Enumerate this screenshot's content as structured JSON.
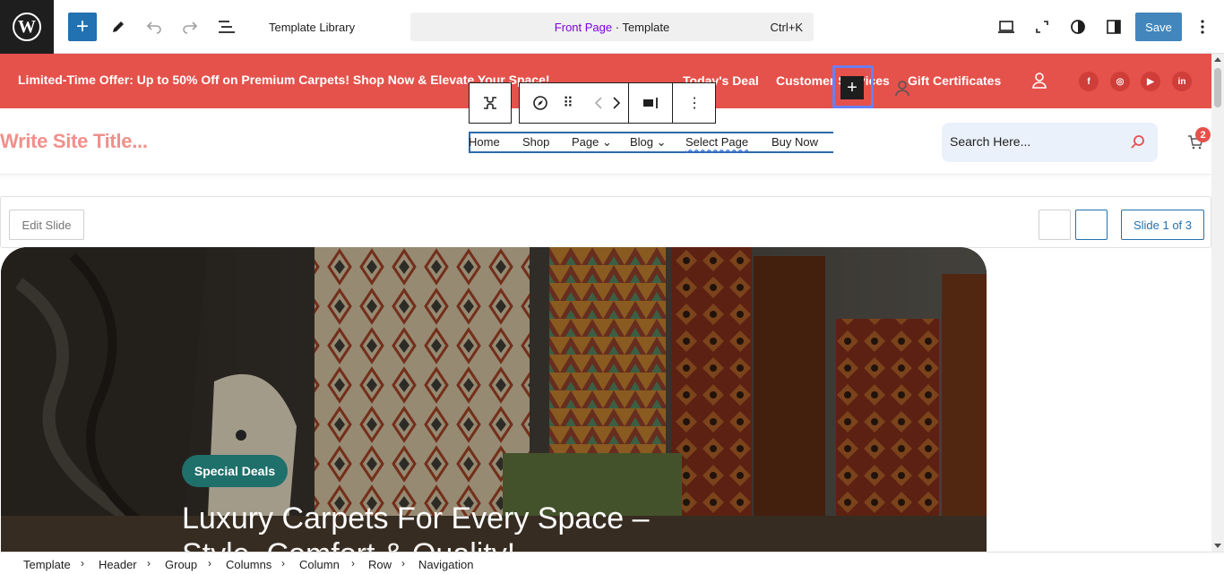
{
  "editor": {
    "template_library": "Template Library",
    "command": {
      "page": "Front Page",
      "sep": " · ",
      "type": "Template",
      "shortcut": "Ctrl+K"
    },
    "save": "Save",
    "wp": "W",
    "add": "+"
  },
  "promo": {
    "offer": "Limited-Time Offer: Up to 50% Off on Premium Carpets! Shop Now & Elevate Your Space!",
    "links": [
      "Today's Deal",
      "Customer Services",
      "Gift Certificates"
    ],
    "social": [
      "f",
      "◎",
      "▶",
      "in"
    ]
  },
  "header": {
    "site_title": "Write Site Title...",
    "nav": [
      "Home",
      "Shop",
      "Page ⌄",
      "Blog ⌄",
      "Select Page",
      "Buy Now"
    ],
    "nav_add": "+",
    "search_placeholder": "Search Here...",
    "cart_count": "2"
  },
  "block_toolbar": {
    "more": "⋮",
    "move": "⠿"
  },
  "slider": {
    "edit": "Edit Slide",
    "count": "Slide 1 of 3"
  },
  "hero": {
    "badge": "Special Deals",
    "title_line1": "Luxury Carpets For Every Space –",
    "title_line2": "Style, Comfort & Quality!"
  },
  "breadcrumb": [
    "Template",
    "Header",
    "Group",
    "Columns",
    "Column",
    "Row",
    "Navigation"
  ],
  "colors": {
    "brand_red": "#e5514b",
    "accent_blue": "#2271b1",
    "badge_teal": "#1f6f6b",
    "title_pink": "#f0908b"
  }
}
